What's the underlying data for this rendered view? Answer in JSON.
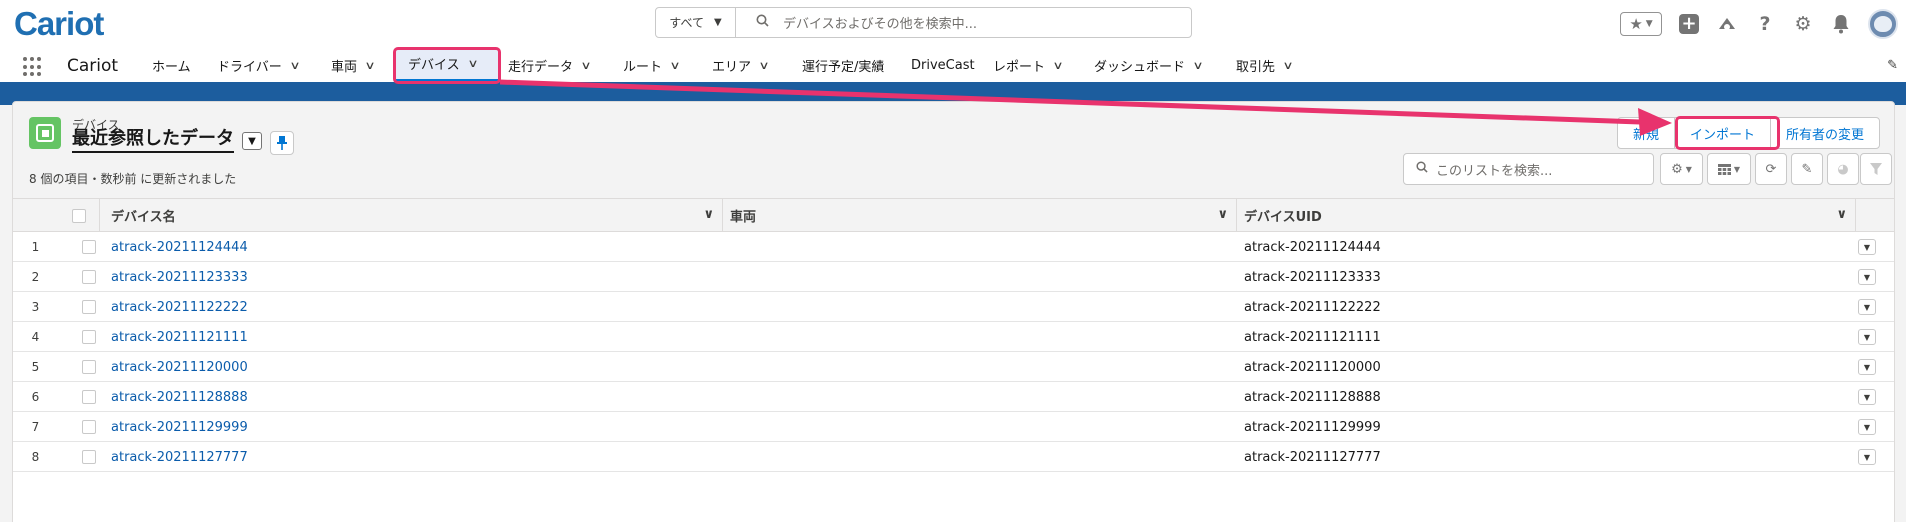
{
  "header": {
    "logo": "Cariot",
    "search_scope": "すべて",
    "search_placeholder": "デバイスおよびその他を検索中..."
  },
  "nav": {
    "app_name": "Cariot",
    "items": [
      {
        "label": "ホーム",
        "dropdown": false
      },
      {
        "label": "ドライバー",
        "dropdown": true
      },
      {
        "label": "車両",
        "dropdown": true
      },
      {
        "label": "デバイス",
        "dropdown": true,
        "active": true
      },
      {
        "label": "走行データ",
        "dropdown": true
      },
      {
        "label": "ルート",
        "dropdown": true
      },
      {
        "label": "エリア",
        "dropdown": true
      },
      {
        "label": "運行予定/実績",
        "dropdown": false
      },
      {
        "label": "DriveCast",
        "dropdown": false
      },
      {
        "label": "レポート",
        "dropdown": true
      },
      {
        "label": "ダッシュボード",
        "dropdown": true
      },
      {
        "label": "取引先",
        "dropdown": true
      }
    ]
  },
  "list": {
    "object_label": "デバイス",
    "title": "最近参照したデータ",
    "meta": "8 個の項目・数秒前 に更新されました",
    "actions": {
      "new": "新規",
      "import": "インポート",
      "change_owner": "所有者の変更"
    },
    "search_placeholder": "このリストを検索...",
    "columns": [
      "デバイス名",
      "車両",
      "デバイスUID"
    ],
    "rows": [
      {
        "num": "1",
        "name": "atrack-20211124444",
        "vehicle": "",
        "uid": "atrack-20211124444"
      },
      {
        "num": "2",
        "name": "atrack-20211123333",
        "vehicle": "",
        "uid": "atrack-20211123333"
      },
      {
        "num": "3",
        "name": "atrack-20211122222",
        "vehicle": "",
        "uid": "atrack-20211122222"
      },
      {
        "num": "4",
        "name": "atrack-20211121111",
        "vehicle": "",
        "uid": "atrack-20211121111"
      },
      {
        "num": "5",
        "name": "atrack-20211120000",
        "vehicle": "",
        "uid": "atrack-20211120000"
      },
      {
        "num": "6",
        "name": "atrack-20211128888",
        "vehicle": "",
        "uid": "atrack-20211128888"
      },
      {
        "num": "7",
        "name": "atrack-20211129999",
        "vehicle": "",
        "uid": "atrack-20211129999"
      },
      {
        "num": "8",
        "name": "atrack-20211127777",
        "vehicle": "",
        "uid": "atrack-20211127777"
      }
    ]
  },
  "colors": {
    "brand_blue": "#1c5d9e",
    "link": "#0b5cab",
    "highlight": "#e8336d",
    "object_icon": "#65c464"
  },
  "icons": [
    "search-icon",
    "star-icon",
    "plus-icon",
    "cloud-icon",
    "help-icon",
    "gear-icon",
    "bell-icon",
    "avatar",
    "waffle-icon",
    "pencil-icon",
    "pin-icon",
    "refresh-icon",
    "table-icon",
    "filter-icon",
    "chart-icon"
  ]
}
